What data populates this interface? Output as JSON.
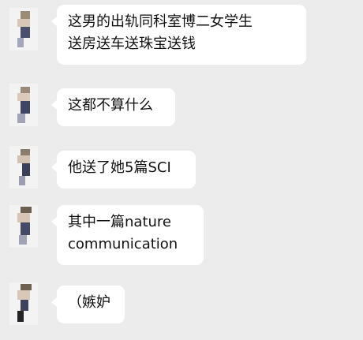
{
  "messages": [
    {
      "text": "这男的出轨同科室博二女学生\n送房送车送珠宝送钱"
    },
    {
      "text": "这都不算什么"
    },
    {
      "text": "他送了她5篇SCI"
    },
    {
      "text": "其中一篇nature\ncommunication"
    },
    {
      "text": "（嫉妒"
    }
  ]
}
